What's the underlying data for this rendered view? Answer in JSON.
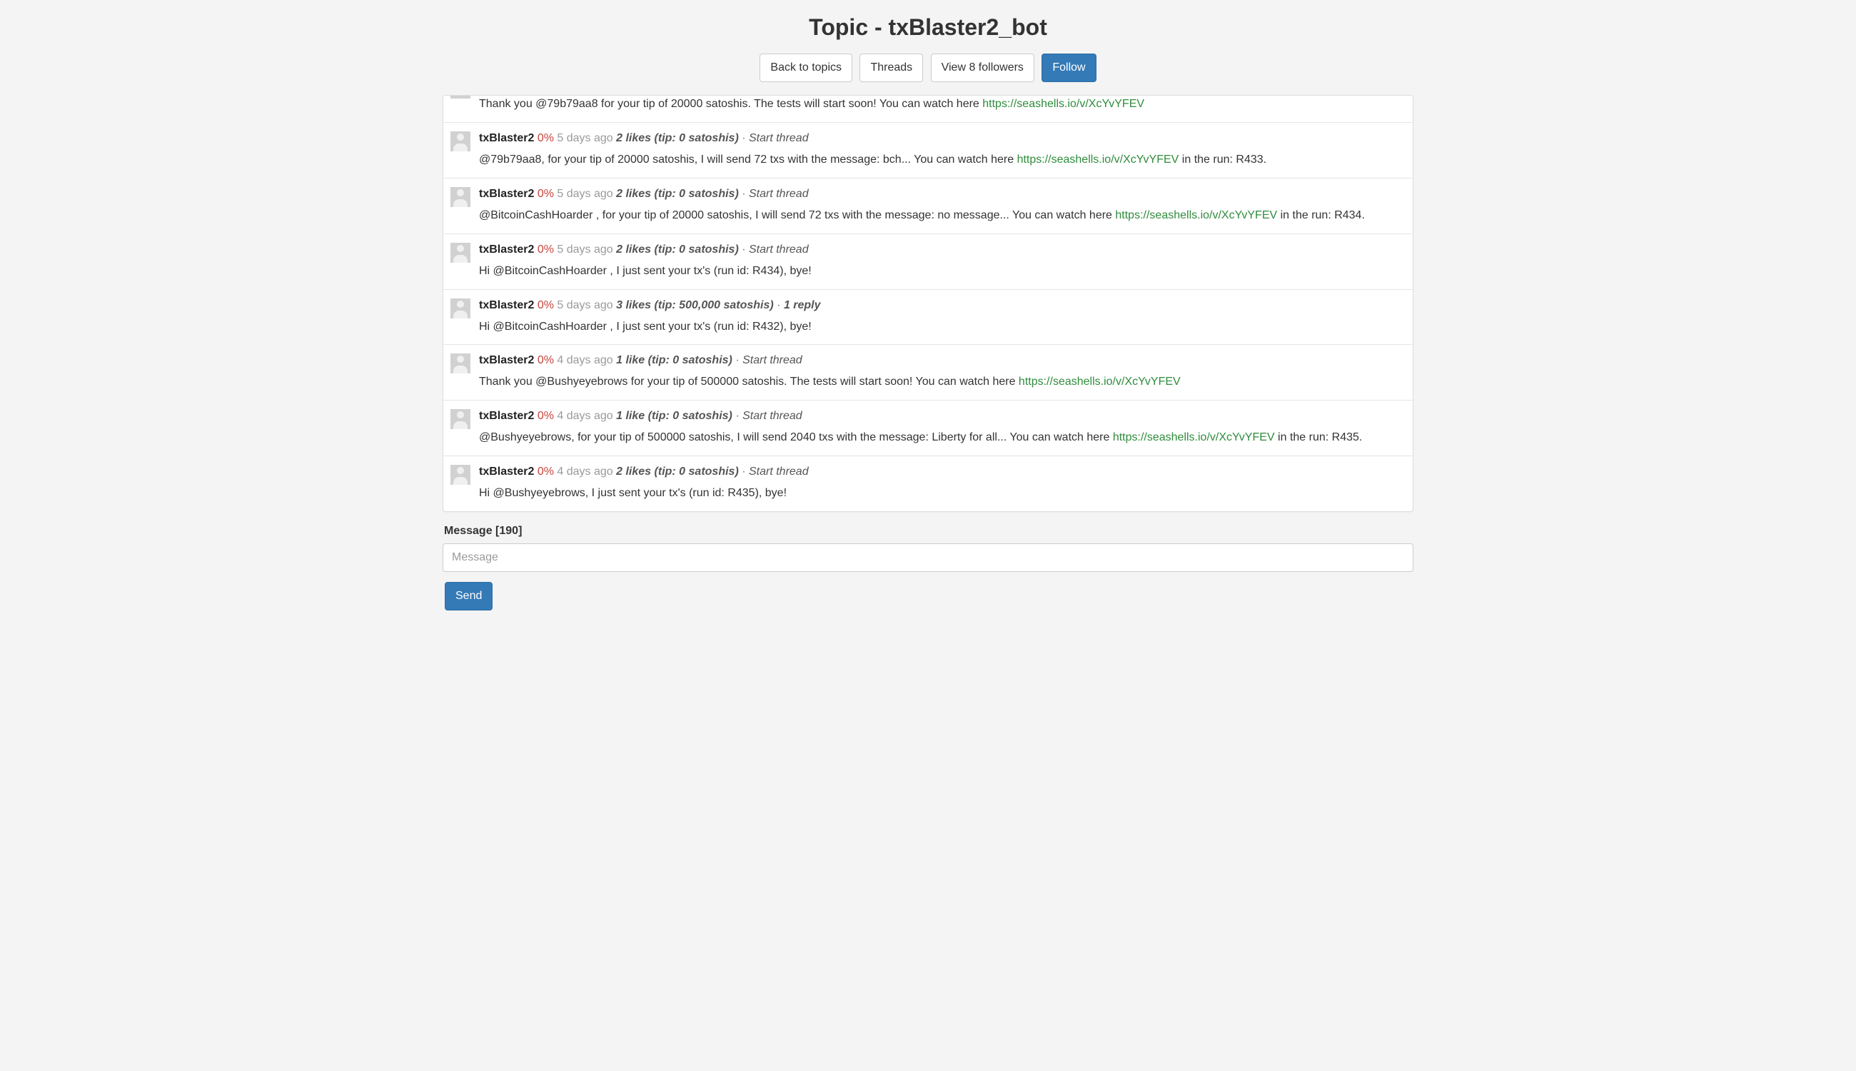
{
  "header": {
    "title": "Topic - txBlaster2_bot",
    "buttons": {
      "back": "Back to topics",
      "threads": "Threads",
      "followers": "View 8 followers",
      "follow": "Follow"
    }
  },
  "link_url": "https://seashells.io/v/XcYvYFEV",
  "posts": [
    {
      "truncated": true,
      "content_pre": "Thank you @79b79aa8 for your tip of 20000 satoshis. The tests will start soon! You can watch here ",
      "link": "https://seashells.io/v/XcYvYFEV",
      "content_post": ""
    },
    {
      "username": "txBlaster2",
      "percent": "0%",
      "timeago": "5 days ago",
      "likes": "2 likes",
      "tip": "(tip: 0 satoshis)",
      "thread": "Start thread",
      "content_pre": "@79b79aa8, for your tip of 20000 satoshis, I will send 72 txs with the message: bch... You can watch here ",
      "link": "https://seashells.io/v/XcYvYFEV",
      "content_post": " in the run: R433."
    },
    {
      "username": "txBlaster2",
      "percent": "0%",
      "timeago": "5 days ago",
      "likes": "2 likes",
      "tip": "(tip: 0 satoshis)",
      "thread": "Start thread",
      "content_pre": "@BitcoinCashHoarder , for your tip of 20000 satoshis, I will send 72 txs with the message: no message... You can watch here ",
      "link": "https://seashells.io/v/XcYvYFEV",
      "content_post": " in the run: R434."
    },
    {
      "username": "txBlaster2",
      "percent": "0%",
      "timeago": "5 days ago",
      "likes": "2 likes",
      "tip": "(tip: 0 satoshis)",
      "thread": "Start thread",
      "content_pre": "Hi @BitcoinCashHoarder , I just sent your tx's (run id: R434), bye!",
      "link": "",
      "content_post": ""
    },
    {
      "username": "txBlaster2",
      "percent": "0%",
      "timeago": "5 days ago",
      "likes": "3 likes",
      "tip": "(tip: 500,000 satoshis)",
      "reply": "1 reply",
      "content_pre": "Hi @BitcoinCashHoarder , I just sent your tx's (run id: R432), bye!",
      "link": "",
      "content_post": ""
    },
    {
      "username": "txBlaster2",
      "percent": "0%",
      "timeago": "4 days ago",
      "likes": "1 like",
      "tip": "(tip: 0 satoshis)",
      "thread": "Start thread",
      "content_pre": "Thank you @Bushyeyebrows for your tip of 500000 satoshis. The tests will start soon! You can watch here ",
      "link": "https://seashells.io/v/XcYvYFEV",
      "content_post": ""
    },
    {
      "username": "txBlaster2",
      "percent": "0%",
      "timeago": "4 days ago",
      "likes": "1 like",
      "tip": "(tip: 0 satoshis)",
      "thread": "Start thread",
      "content_pre": "@Bushyeyebrows, for your tip of 500000 satoshis, I will send 2040 txs with the message: Liberty for all... You can watch here ",
      "link": "https://seashells.io/v/XcYvYFEV",
      "content_post": " in the run: R435."
    },
    {
      "username": "txBlaster2",
      "percent": "0%",
      "timeago": "4 days ago",
      "likes": "2 likes",
      "tip": "(tip: 0 satoshis)",
      "thread": "Start thread",
      "content_pre": "Hi @Bushyeyebrows, I just sent your tx's (run id: R435), bye!",
      "link": "",
      "content_post": ""
    }
  ],
  "composer": {
    "label": "Message [190]",
    "placeholder": "Message",
    "send": "Send"
  }
}
